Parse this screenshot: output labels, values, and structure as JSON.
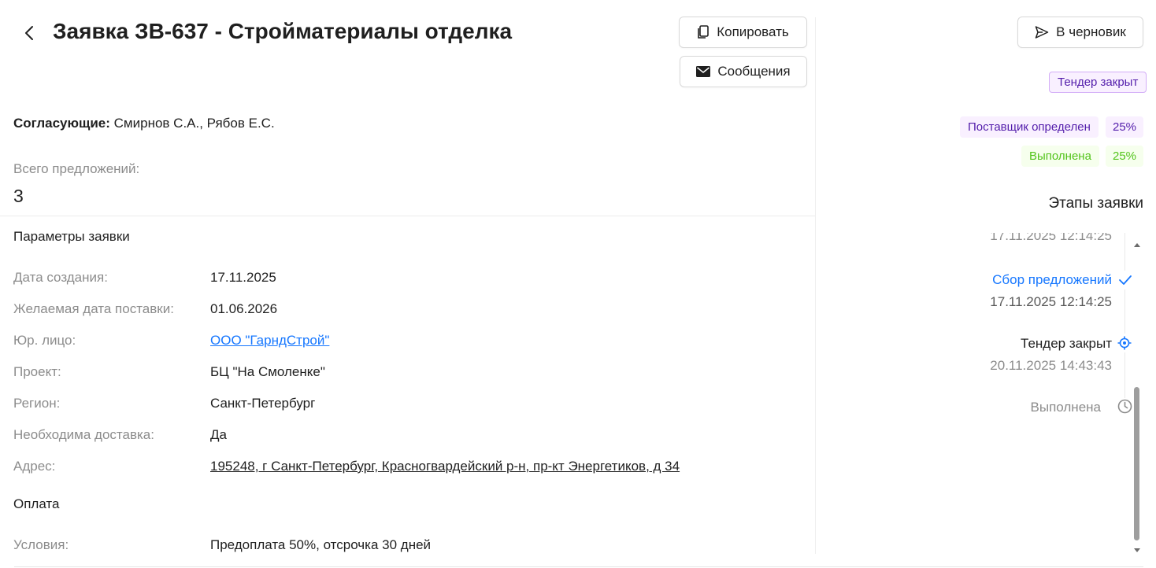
{
  "header": {
    "title": "Заявка ЗВ-637 - Стройматериалы отделка",
    "copy_label": "Копировать",
    "messages_label": "Сообщения",
    "draft_label": "В черновик"
  },
  "approvers": {
    "label": "Согласующие:",
    "value": "Смирнов С.А., Рябов Е.С."
  },
  "offers": {
    "label": "Всего предложений:",
    "value": "3"
  },
  "params": {
    "section_title": "Параметры заявки",
    "rows": [
      {
        "label": "Дата создания:",
        "value": "17.11.2025"
      },
      {
        "label": "Желаемая дата поставки:",
        "value": "01.06.2026"
      },
      {
        "label": "Юр. лицо:",
        "value": "ООО \"ГарндСтрой\""
      },
      {
        "label": "Проект:",
        "value": "БЦ \"На Смоленке\""
      },
      {
        "label": "Регион:",
        "value": "Санкт-Петербург"
      },
      {
        "label": "Необходима доставка:",
        "value": "Да"
      },
      {
        "label": "Адрес:",
        "value": "195248, г Санкт-Петербург, Красногвардейский р-н, пр-кт Энергетиков, д 34"
      }
    ]
  },
  "payment": {
    "section_title": "Оплата",
    "rows": [
      {
        "label": "Условия:",
        "value": "Предоплата 50%, отсрочка 30 дней"
      }
    ]
  },
  "status": {
    "main_tag": "Тендер закрыт",
    "progress": [
      {
        "label": "Поставщик определен",
        "percent": "25%"
      },
      {
        "label": "Выполнена",
        "percent": "25%"
      }
    ]
  },
  "stages": {
    "title": "Этапы заявки",
    "items": [
      {
        "title": "",
        "date": "17.11.2025 12:14:25"
      },
      {
        "title": "Сбор предложений",
        "date": "17.11.2025 12:14:25"
      },
      {
        "title": "Тендер закрыт",
        "date": "20.11.2025 14:43:43"
      },
      {
        "title": "Выполнена",
        "date": ""
      }
    ]
  },
  "colors": {
    "accent": "#1677ff",
    "purple": "#531dab",
    "green": "#52c41a",
    "muted": "#8c8c8c"
  },
  "icons": {
    "back": "chevron-left-icon",
    "copy": "copy-icon",
    "messages": "envelope-icon",
    "draft": "send-icon",
    "done": "check-icon",
    "current": "crosshair-icon",
    "pending": "clock-icon"
  }
}
